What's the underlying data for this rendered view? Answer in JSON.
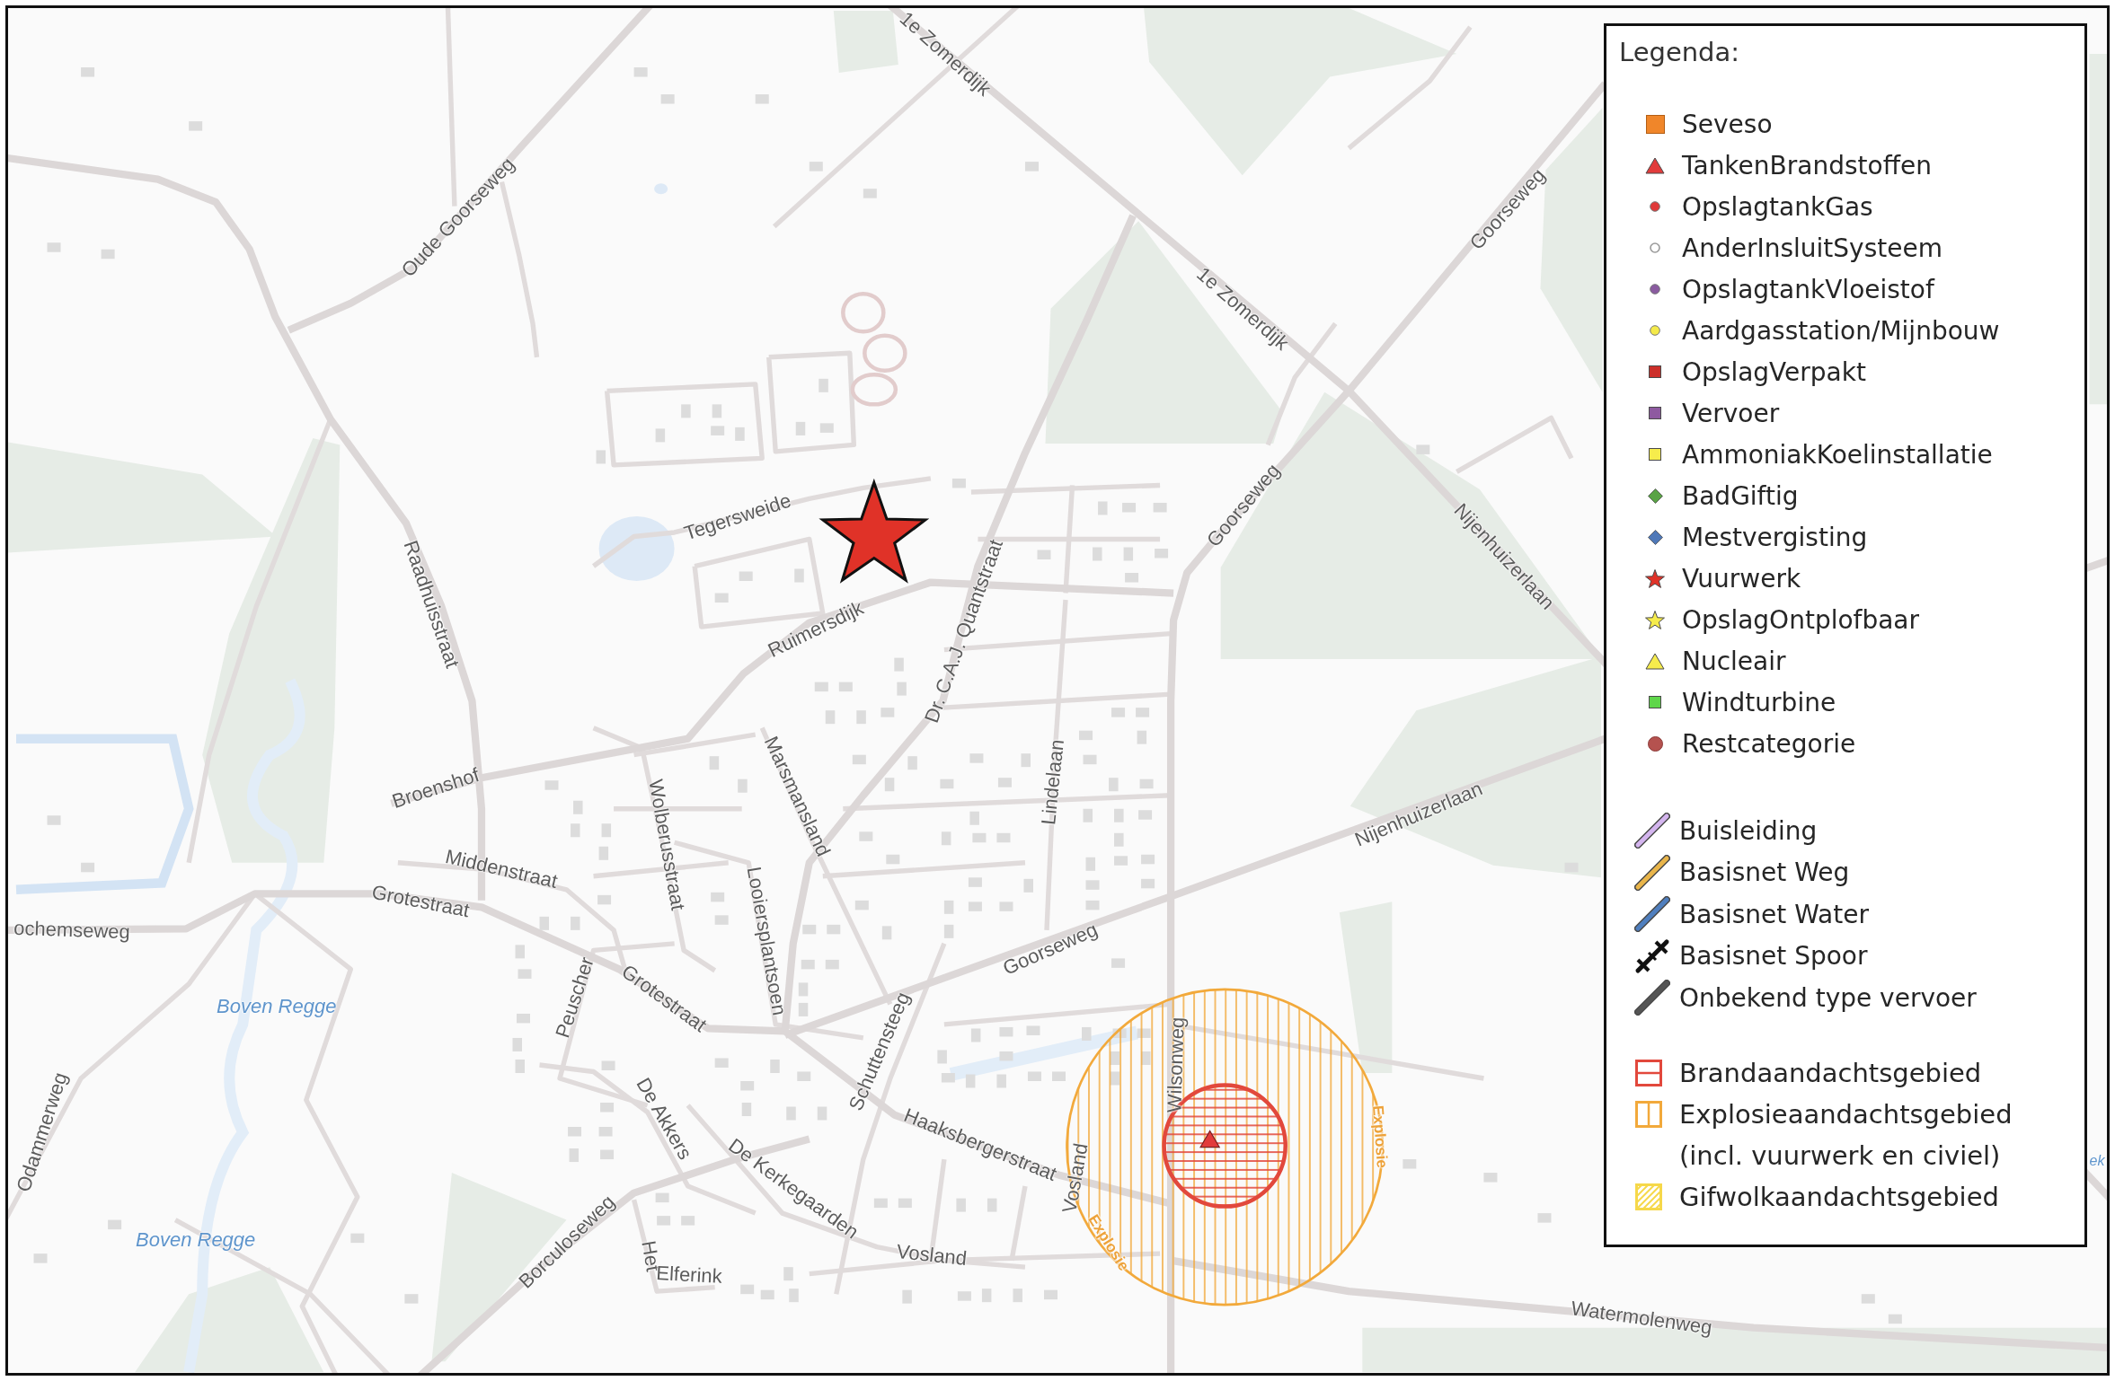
{
  "map": {
    "street_labels": [
      "1e Zomerdijk",
      "Oude Goorseweg",
      "Goorseweg",
      "1e Zomerdijk",
      "Goorseweg",
      "Tegersweide",
      "Nijenhuizerlaan",
      "Raadhuisstraat",
      "Ruimersdijk",
      "Dr. C.A.J. Quantstraat",
      "Broenshof",
      "Marsmansland",
      "Lindelaan",
      "Nijenhuizerlaan",
      "Wolberusstraat",
      "Middenstraat",
      "Grotestraat",
      "ochemseweg",
      "Looiersplantsoen",
      "Goorseweg",
      "Peuscher",
      "Grotestraat",
      "Schuttensteeg",
      "Wilsonweg",
      "De Akkers",
      "Odammerweg",
      "Haaksbergerstraat",
      "De Kerkegaarden",
      "Vosland",
      "Borculoseweg",
      "Het",
      "Vosland",
      "Elferink",
      "Watermolenweg"
    ],
    "water_labels": [
      "Boven Regge",
      "Boven Regge",
      "ek"
    ],
    "zone_labels": [
      "Explosie",
      "Explosie"
    ]
  },
  "legend": {
    "title": "Legenda:",
    "points": [
      {
        "label": "Seveso",
        "kind": "tile",
        "color": "#f0862a"
      },
      {
        "label": "TankenBrandstoffen",
        "kind": "triangle",
        "color": "#e23b3b"
      },
      {
        "label": "OpslagtankGas",
        "kind": "dot",
        "color": "#e03a3a"
      },
      {
        "label": "AnderInsluitSysteem",
        "kind": "ring",
        "color": "#9a9a9a"
      },
      {
        "label": "OpslagtankVloeistof",
        "kind": "dot",
        "color": "#8a5ba0"
      },
      {
        "label": "Aardgasstation/Mijnbouw",
        "kind": "dot",
        "color": "#f4ea4a"
      },
      {
        "label": "OpslagVerpakt",
        "kind": "square",
        "color": "#cc2f2a"
      },
      {
        "label": "Vervoer",
        "kind": "square",
        "color": "#8e5aa0"
      },
      {
        "label": "AmmoniakKoelinstallatie",
        "kind": "square",
        "color": "#f6ec4c"
      },
      {
        "label": "BadGiftig",
        "kind": "diamond",
        "color": "#5aa346"
      },
      {
        "label": "Mestvergisting",
        "kind": "diamond",
        "color": "#4f78b8"
      },
      {
        "label": "Vuurwerk",
        "kind": "star",
        "color": "#e03228"
      },
      {
        "label": "OpslagOntplofbaar",
        "kind": "star",
        "color": "#f6ec4c"
      },
      {
        "label": "Nucleair",
        "kind": "triangle",
        "color": "#f6ec4c"
      },
      {
        "label": "Windturbine",
        "kind": "square",
        "color": "#5fd64a"
      },
      {
        "label": "Restcategorie",
        "kind": "disc",
        "color": "#b5524f"
      }
    ],
    "lines": [
      {
        "label": "Buisleiding",
        "kind": "band",
        "color": "#d4b5ef"
      },
      {
        "label": "Basisnet Weg",
        "kind": "band",
        "color": "#e9b54a"
      },
      {
        "label": "Basisnet Water",
        "kind": "band",
        "color": "#4f7fbf"
      },
      {
        "label": "Basisnet Spoor",
        "kind": "rail",
        "color": "#111111"
      },
      {
        "label": "Onbekend type vervoer",
        "kind": "band",
        "color": "#555555"
      }
    ],
    "areas": [
      {
        "label": "Brandaandachtsgebied",
        "kind": "horizontal",
        "color": "#e2483c"
      },
      {
        "label": "Explosieaandachtsgebied\n(incl. vuurwerk en civiel)",
        "kind": "vertical",
        "color": "#f2a93b"
      },
      {
        "label": "Gifwolkaandachtsgebied",
        "kind": "diagonal",
        "color": "#f6d84a"
      }
    ]
  }
}
